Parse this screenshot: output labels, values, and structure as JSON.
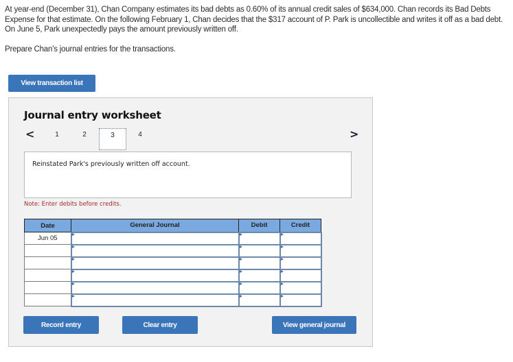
{
  "problem": {
    "paragraph": "At year-end (December 31), Chan Company estimates its bad debts as 0.60% of its annual credit sales of $634,000. Chan records its Bad Debts Expense for that estimate. On the following February 1, Chan decides that the $317 account of P. Park is uncollectible and writes it off as a bad debt. On June 5, Park unexpectedly pays the amount previously written off.",
    "instruction": "Prepare Chan's journal entries for the transactions."
  },
  "buttons": {
    "view_transaction_list": "View transaction list",
    "record_entry": "Record entry",
    "clear_entry": "Clear entry",
    "view_general_journal": "View general journal"
  },
  "worksheet": {
    "title": "Journal entry worksheet",
    "nav_prev_icon": "<",
    "nav_next_icon": ">",
    "tabs": [
      {
        "label": "1",
        "active": false
      },
      {
        "label": "2",
        "active": false
      },
      {
        "label": "3",
        "active": true
      },
      {
        "label": "4",
        "active": false
      }
    ],
    "description": "Reinstated Park's previously written off account.",
    "note": "Note: Enter debits before credits."
  },
  "journal": {
    "headers": {
      "date": "Date",
      "general_journal": "General Journal",
      "debit": "Debit",
      "credit": "Credit"
    },
    "rows": [
      {
        "date": "Jun 05",
        "account": "",
        "debit": "",
        "credit": ""
      },
      {
        "date": "",
        "account": "",
        "debit": "",
        "credit": ""
      },
      {
        "date": "",
        "account": "",
        "debit": "",
        "credit": ""
      },
      {
        "date": "",
        "account": "",
        "debit": "",
        "credit": ""
      },
      {
        "date": "",
        "account": "",
        "debit": "",
        "credit": ""
      },
      {
        "date": "",
        "account": "",
        "debit": "",
        "credit": ""
      }
    ]
  },
  "colors": {
    "button_blue": "#3a75b9",
    "header_blue": "#79a9de",
    "note_red": "#a3262c",
    "panel_bg": "#f2f2f2"
  }
}
